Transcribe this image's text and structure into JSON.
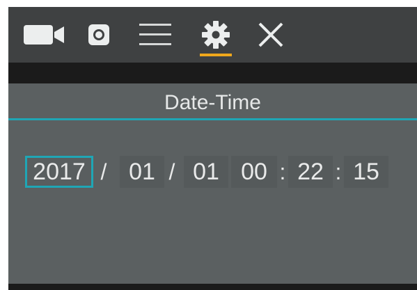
{
  "toolbar": {
    "icons": [
      {
        "name": "video-camera-icon",
        "active": false
      },
      {
        "name": "photo-camera-icon",
        "active": false
      },
      {
        "name": "menu-icon",
        "active": false
      },
      {
        "name": "settings-gear-icon",
        "active": true
      },
      {
        "name": "close-icon",
        "active": false
      }
    ],
    "icon_color": "#eceeee",
    "active_color": "#f0a81c"
  },
  "panel": {
    "title": "Date-Time",
    "accent_color": "#1fa6b5"
  },
  "datetime": {
    "year": "2017",
    "sep1": "/",
    "month": "01",
    "sep2": "/",
    "day": "01",
    "hour": "00",
    "sep3": ":",
    "minute": "22",
    "sep4": ":",
    "second": "15",
    "selected_field": "year"
  }
}
